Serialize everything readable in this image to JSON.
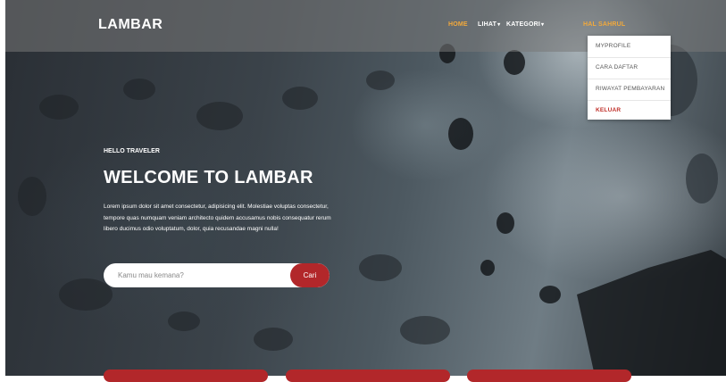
{
  "navbar": {
    "brand": "LAMBAR",
    "menu": {
      "home": "HOME",
      "lihat": "LIHAT",
      "kategori": "KATEGORI",
      "user": "HAL SAHRUL"
    },
    "caret_icon": "chevron-down-icon",
    "home_color": "#f2a93b"
  },
  "dropdown": {
    "items": [
      "MYPROFILE",
      "CARA DAFTAR",
      "RIWAYAT PEMBAYARAN",
      "KELUAR"
    ],
    "logout_color": "#c0302a"
  },
  "hero": {
    "eyebrow": "HELLO TRAVELER",
    "title": "WELCOME TO LAMBAR",
    "description": "Lorem ipsum dolor sit amet consectetur, adipisicing elit. Molestiae voluptas consectetur, tempore quas numquam veniam architecto quidem accusamus nobis consequatur rerum libero ducimus odio voluptatum, dolor, quia recusandae magni nulla!"
  },
  "search": {
    "placeholder": "Kamu mau kemana?",
    "button_label": "Cari",
    "button_color": "#b2272a"
  }
}
